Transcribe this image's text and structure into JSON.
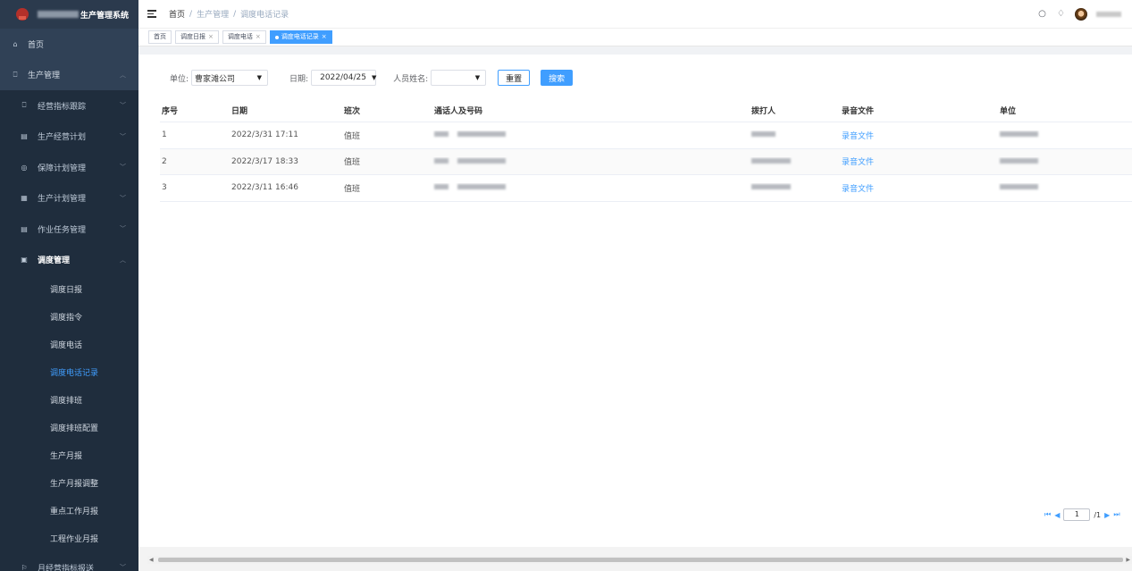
{
  "app": {
    "title_suffix": "生产管理系统"
  },
  "sidebar": {
    "items": [
      {
        "name": "home",
        "label": "首页",
        "icon": "dashboard-icon",
        "glyph": "⌂",
        "level": "top"
      },
      {
        "name": "production",
        "label": "生产管理",
        "icon": "book-icon",
        "glyph": "⎕",
        "level": "top",
        "arrow": "︿"
      },
      {
        "name": "kpi-tracking",
        "label": "经营指标跟踪",
        "icon": "book-icon",
        "glyph": "⎕",
        "level": "sub",
        "arrow": "﹀"
      },
      {
        "name": "business-plan",
        "label": "生产经营计划",
        "icon": "calendar-icon",
        "glyph": "▤",
        "level": "sub",
        "arrow": "﹀"
      },
      {
        "name": "maintenance-plan",
        "label": "保障计划管理",
        "icon": "target-icon",
        "glyph": "◎",
        "level": "sub",
        "arrow": "﹀"
      },
      {
        "name": "production-plan",
        "label": "生产计划管理",
        "icon": "grid-icon",
        "glyph": "▦",
        "level": "sub",
        "arrow": "﹀"
      },
      {
        "name": "task-management",
        "label": "作业任务管理",
        "icon": "list-icon",
        "glyph": "▤",
        "level": "sub",
        "arrow": "﹀"
      },
      {
        "name": "dispatch-management",
        "label": "调度管理",
        "icon": "monitor-icon",
        "glyph": "▣",
        "level": "sub-bold",
        "arrow": "︿"
      }
    ],
    "leaves": [
      {
        "name": "dispatch-daily",
        "label": "调度日报"
      },
      {
        "name": "dispatch-order",
        "label": "调度指令"
      },
      {
        "name": "dispatch-phone",
        "label": "调度电话"
      },
      {
        "name": "dispatch-phone-log",
        "label": "调度电话记录",
        "active": true
      },
      {
        "name": "dispatch-shift",
        "label": "调度排班"
      },
      {
        "name": "dispatch-shift-config",
        "label": "调度排班配置"
      },
      {
        "name": "production-monthly",
        "label": "生产月报"
      },
      {
        "name": "production-monthly-adjust",
        "label": "生产月报调整"
      },
      {
        "name": "key-work-monthly",
        "label": "重点工作月报"
      },
      {
        "name": "engineering-monthly",
        "label": "工程作业月报"
      }
    ],
    "bottom_item": {
      "label": "月经营指标报送",
      "glyph": "⚐",
      "arrow": "﹀"
    }
  },
  "header": {
    "breadcrumb": [
      "首页",
      "/",
      "生产管理",
      "/",
      "调度电话记录"
    ]
  },
  "tags": [
    {
      "label": "首页",
      "closable": false,
      "active": false
    },
    {
      "label": "调度日报",
      "closable": true,
      "active": false
    },
    {
      "label": "调度电话",
      "closable": true,
      "active": false
    },
    {
      "label": "调度电话记录",
      "closable": true,
      "active": true
    }
  ],
  "filters": {
    "unit_label": "单位:",
    "unit_value": "曹家滩公司",
    "date_label": "日期:",
    "date_value": "2022/04/25",
    "person_label": "人员姓名:",
    "person_value": "",
    "reset_label": "重置",
    "search_label": "搜索"
  },
  "table": {
    "columns": [
      "序号",
      "日期",
      "班次",
      "通话人及号码",
      "拨打人",
      "录音文件",
      "单位"
    ],
    "rows": [
      {
        "index": "1",
        "date": "2022/3/31 17:11",
        "shift": "值班",
        "file": "录音文件"
      },
      {
        "index": "2",
        "date": "2022/3/17 18:33",
        "shift": "值班",
        "file": "录音文件"
      },
      {
        "index": "3",
        "date": "2022/3/11 16:46",
        "shift": "值班",
        "file": "录音文件"
      }
    ]
  },
  "pagination": {
    "current": "1",
    "total": "/1"
  },
  "colors": {
    "sidebar_bg": "#304156",
    "accent": "#409eff",
    "logo_red": "#b3302a"
  }
}
